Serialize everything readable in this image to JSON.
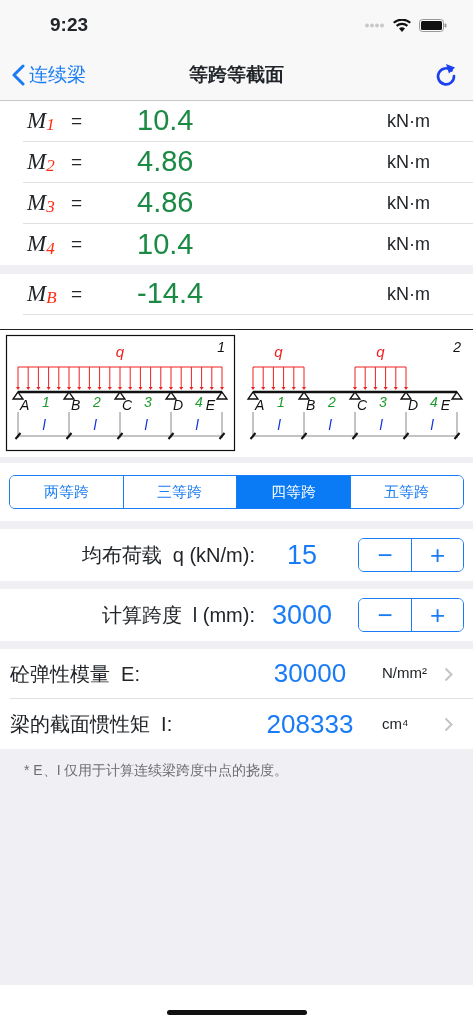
{
  "status_bar": {
    "time": "9:23"
  },
  "nav": {
    "back": "连续梁",
    "title": "等跨等截面"
  },
  "result_groups": [
    {
      "rows": [
        {
          "symbol": "M$_{1}$",
          "equals": "=",
          "value": "10.4",
          "unit": "kN·m"
        },
        {
          "symbol": "M$_{2}$",
          "equals": "=",
          "value": "4.86",
          "unit": "kN·m"
        },
        {
          "symbol": "M$_{3}$",
          "equals": "=",
          "value": "4.86",
          "unit": "kN·m"
        },
        {
          "symbol": "M$_{4}$",
          "equals": "=",
          "value": "10.4",
          "unit": "kN·m"
        }
      ]
    },
    {
      "rows": [
        {
          "symbol": "M$_{B}$",
          "equals": "=",
          "value": "-14.4",
          "unit": "kN·m"
        }
      ]
    }
  ],
  "diagrams": [
    {
      "number": "1",
      "selected": true,
      "load_labels": [
        "q"
      ],
      "supports": [
        "A",
        "B",
        "C",
        "D",
        "E"
      ],
      "spans": [
        {
          "label": "1",
          "length": "l",
          "loaded": true
        },
        {
          "label": "2",
          "length": "l",
          "loaded": true
        },
        {
          "label": "3",
          "length": "l",
          "loaded": true
        },
        {
          "label": "4",
          "length": "l",
          "loaded": true
        }
      ]
    },
    {
      "number": "2",
      "selected": false,
      "load_labels": [
        "q",
        "q"
      ],
      "supports": [
        "A",
        "B",
        "C",
        "D",
        "E"
      ],
      "spans": [
        {
          "label": "1",
          "length": "l",
          "loaded": true
        },
        {
          "label": "2",
          "length": "l",
          "loaded": false
        },
        {
          "label": "3",
          "length": "l",
          "loaded": true
        },
        {
          "label": "4",
          "length": "l",
          "loaded": false
        }
      ]
    }
  ],
  "span_tabs": [
    {
      "label": "两等跨",
      "selected": false
    },
    {
      "label": "三等跨",
      "selected": false
    },
    {
      "label": "四等跨",
      "selected": true
    },
    {
      "label": "五等跨",
      "selected": false
    }
  ],
  "inputs": [
    {
      "label": "均布荷载  q (kN/m):",
      "value": "15",
      "minus": "−",
      "plus": "+"
    },
    {
      "label": "计算跨度  l (mm):",
      "value": "3000",
      "minus": "−",
      "plus": "+"
    }
  ],
  "properties": [
    {
      "label": "砼弹性模量  E:",
      "value": "30000",
      "unit": "N/mm²"
    },
    {
      "label": "梁的截面惯性矩  I:",
      "value": "208333",
      "unit": "cm⁴"
    }
  ],
  "footnote": "* E、I 仅用于计算连续梁跨度中点的挠度。"
}
